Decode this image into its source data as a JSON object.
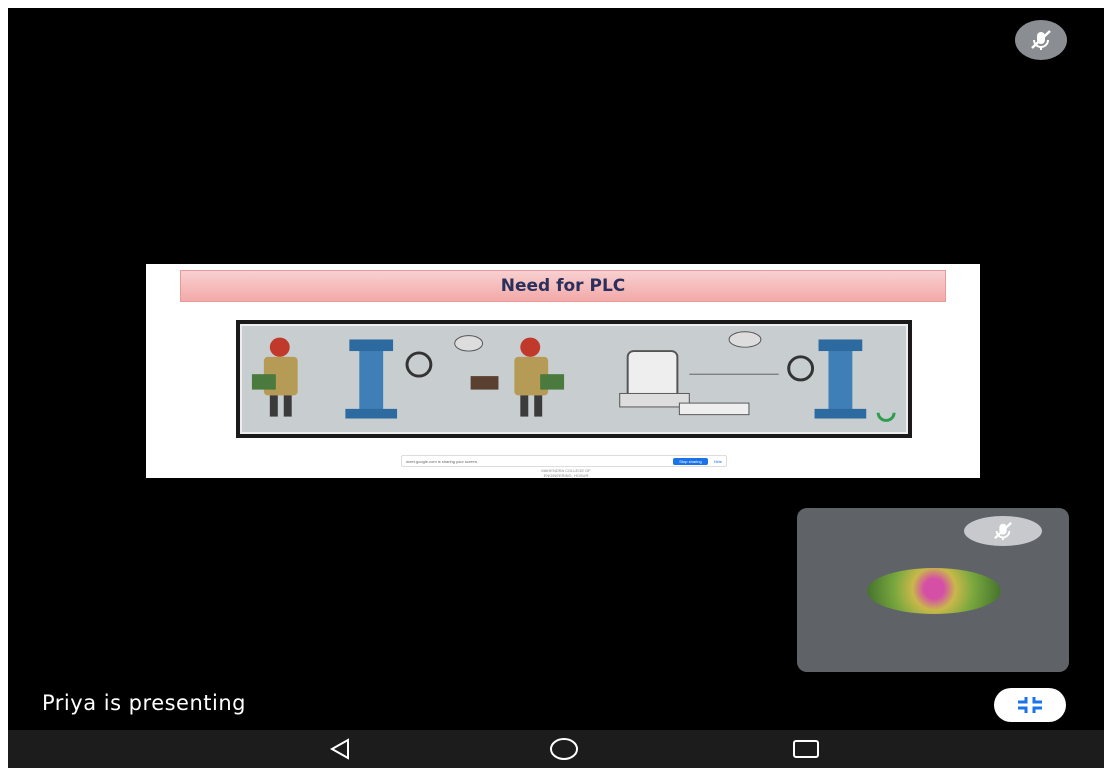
{
  "meeting": {
    "presenter_status": "Priya is presenting",
    "participant_muted": true,
    "presenter_muted": true
  },
  "slide": {
    "title": "Need for  PLC",
    "share_banner": {
      "text": "meet.google.com is sharing your screen.",
      "stop_label": "Stop sharing",
      "hide_label": "Hide"
    },
    "footer_lines": [
      "MAHENDRA COLLEGE OF",
      "ENGINEERING, HOSUR"
    ]
  },
  "icons": {
    "mute": "microphone-off-icon",
    "minimize": "exit-fullscreen-icon",
    "back": "back-triangle-icon",
    "home": "home-circle-icon",
    "recents": "recents-square-icon"
  },
  "colors": {
    "background": "#000000",
    "tile": "#5f6368",
    "slide_title_bar": "#f3a9a9",
    "slide_title_text": "#2a2f5c"
  }
}
